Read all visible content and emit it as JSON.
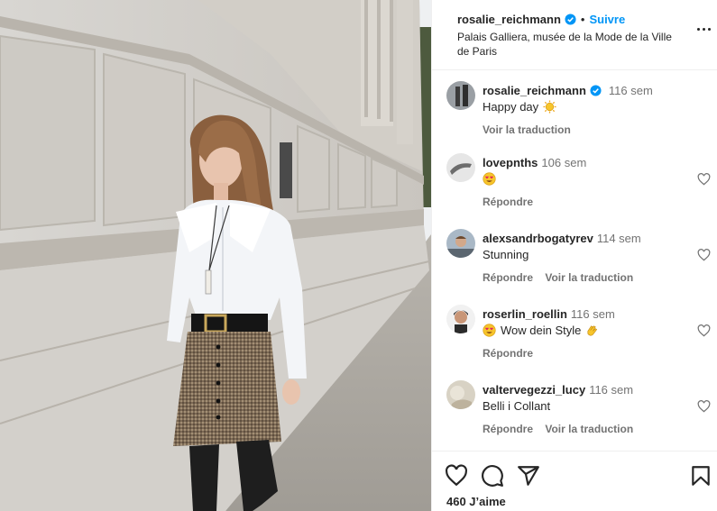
{
  "post": {
    "username": "rosalie_reichmann",
    "separator": "•",
    "follow_label": "Suivre",
    "location": "Palais Galliera, musée de la Mode de la Ville de Paris"
  },
  "caption": {
    "username": "rosalie_reichmann",
    "time": "116 sem",
    "text": "Happy day",
    "emoji": "sun-emoji",
    "translate_label": "Voir la traduction"
  },
  "comments": [
    {
      "username": "lovepnths",
      "time": "106 sem",
      "text": "",
      "emoji": "heart-eyes-emoji",
      "reply_label": "Répondre",
      "translate_label": ""
    },
    {
      "username": "alexsandrbogatyrev",
      "time": "114 sem",
      "text": "Stunning",
      "emoji": "",
      "reply_label": "Répondre",
      "translate_label": "Voir la traduction"
    },
    {
      "username": "roserlin_roellin",
      "time": "116 sem",
      "text": "Wow dein Style",
      "emoji": "heart-eyes-emoji clapping-hands-emoji",
      "reply_label": "Répondre",
      "translate_label": ""
    },
    {
      "username": "valtervegezzi_lucy",
      "time": "116 sem",
      "text": "Belli i Collant",
      "emoji": "",
      "reply_label": "Répondre",
      "translate_label": "Voir la traduction"
    }
  ],
  "actions": {
    "like_icon": "heart-icon",
    "comment_icon": "comment-icon",
    "share_icon": "share-icon",
    "save_icon": "bookmark-icon"
  },
  "likes_text": "460 J’aime",
  "colors": {
    "accent": "#0095f6",
    "text": "#262626",
    "secondary": "#737373",
    "border": "#efefef"
  }
}
